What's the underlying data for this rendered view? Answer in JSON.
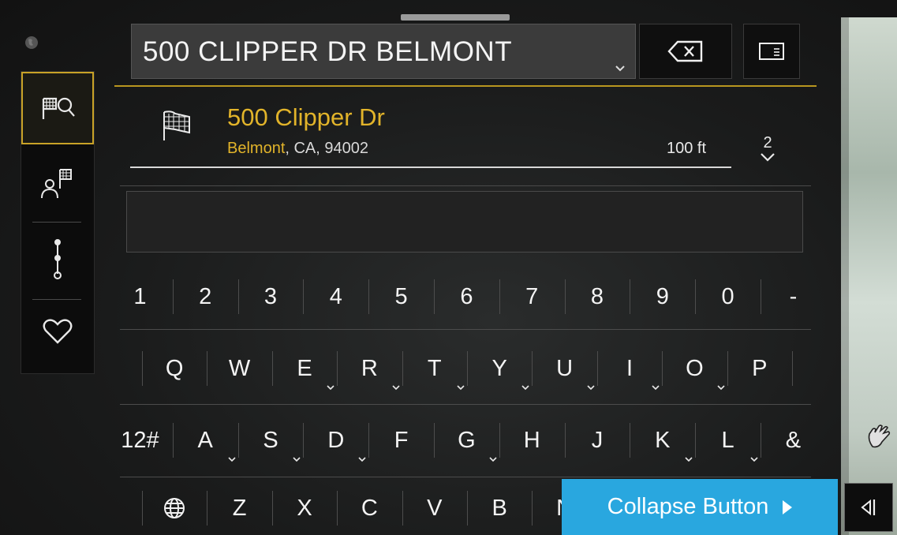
{
  "search": {
    "query": "500 CLIPPER DR BELMONT"
  },
  "result": {
    "title": "500 Clipper Dr",
    "city": "Belmont",
    "rest": ", CA, 94002",
    "distance": "100 ft",
    "count": "2"
  },
  "sidebar": {
    "items": [
      {
        "name": "search-destination",
        "icon": "flag-search-icon",
        "active": true
      },
      {
        "name": "contacts",
        "icon": "person-flag-icon",
        "active": false
      },
      {
        "name": "route",
        "icon": "route-dots-icon",
        "active": false
      },
      {
        "name": "favorites",
        "icon": "heart-icon",
        "active": false
      }
    ]
  },
  "keyboard": {
    "row_numbers": [
      "1",
      "2",
      "3",
      "4",
      "5",
      "6",
      "7",
      "8",
      "9",
      "0",
      "-"
    ],
    "row_qwerty": [
      "Q",
      "W",
      "E",
      "R",
      "T",
      "Y",
      "U",
      "I",
      "O",
      "P"
    ],
    "row_asdf": [
      "12#",
      "A",
      "S",
      "D",
      "F",
      "G",
      "H",
      "J",
      "K",
      "L",
      "&"
    ],
    "row_zxcv": [
      "Z",
      "X",
      "C",
      "V",
      "B",
      "N"
    ]
  },
  "collapse": {
    "label": "Collapse Button"
  },
  "colors": {
    "accent_gold": "#c9a227",
    "button_blue": "#29a7df"
  }
}
